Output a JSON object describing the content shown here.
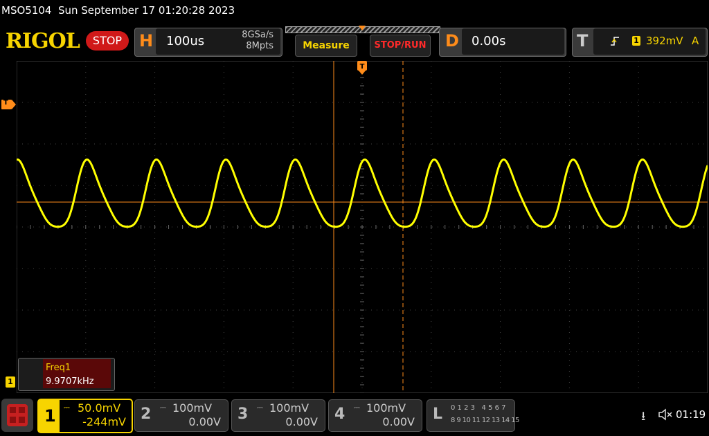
{
  "title": "MSO5104  Sun September 17 01:20:28 2023",
  "brand": "RIGOL",
  "run_state": "STOP",
  "horizontal": {
    "letter": "H",
    "timebase": "100us",
    "sample_rate": "8GSa/s",
    "memory_depth": "8Mpts"
  },
  "buttons": {
    "measure": "Measure",
    "stop_run": "STOP/RUN"
  },
  "delay": {
    "letter": "D",
    "value": "0.00s"
  },
  "trigger": {
    "letter": "T",
    "source": "1",
    "level": "392mV",
    "mode": "A",
    "marker": "T"
  },
  "measurement": {
    "name": "Freq1",
    "value": "9.9707kHz"
  },
  "channels": [
    {
      "num": "1",
      "scale": "50.0mV",
      "offset": "-244mV",
      "active": true
    },
    {
      "num": "2",
      "scale": "100mV",
      "offset": "0.00V",
      "active": false
    },
    {
      "num": "3",
      "scale": "100mV",
      "offset": "0.00V",
      "active": false
    },
    {
      "num": "4",
      "scale": "100mV",
      "offset": "0.00V",
      "active": false
    }
  ],
  "logic": {
    "letter": "L",
    "row1": "0 1 2 3   4 5 6 7",
    "row2": "8 9 10 11 12 13 14 15"
  },
  "ground_marker": "1",
  "clock": "01:19",
  "colors": {
    "ch1": "#ffff00",
    "trigger": "#ff8c1a",
    "grid": "#555555",
    "stop": "#d01919"
  }
}
